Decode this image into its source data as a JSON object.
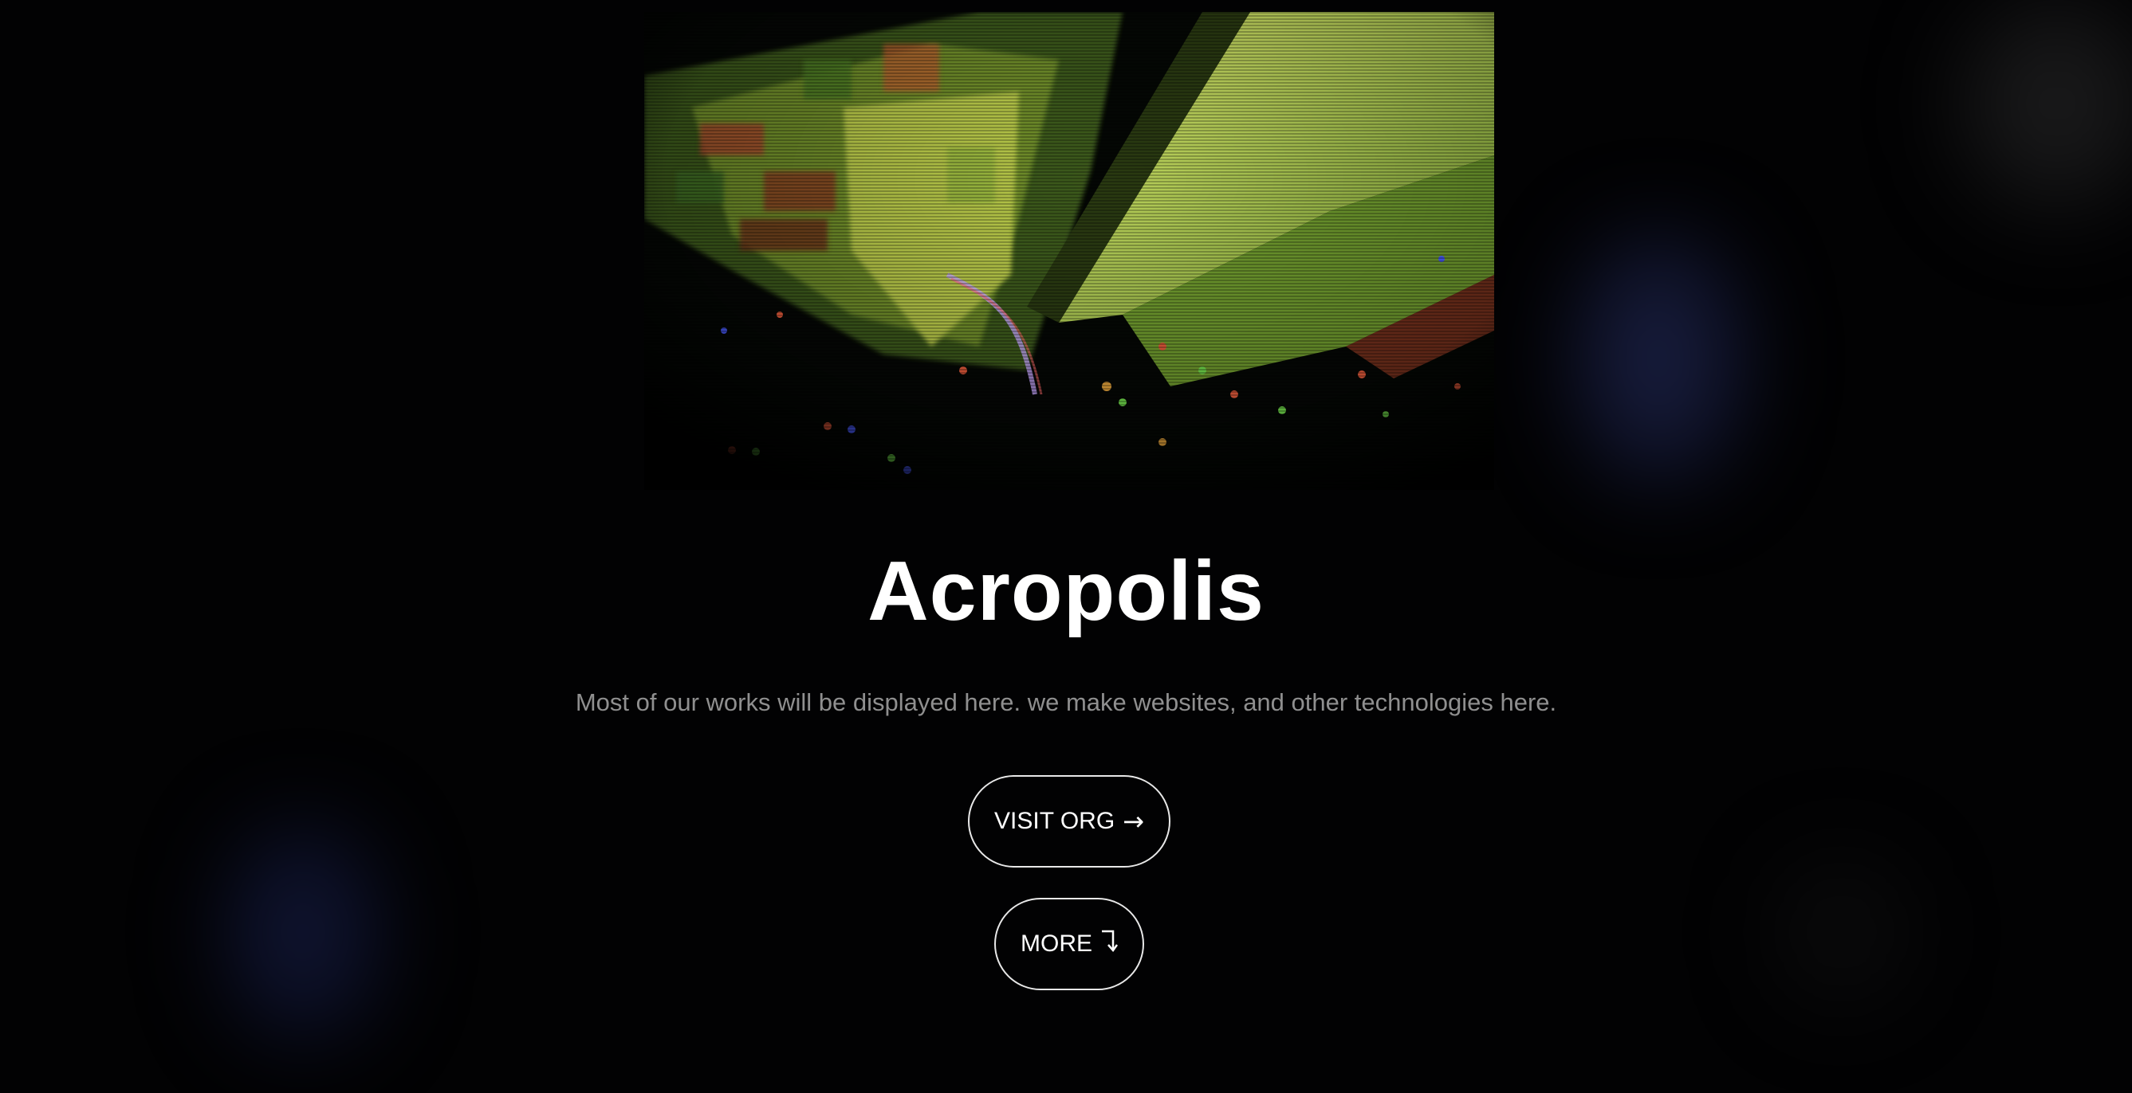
{
  "hero": {
    "title": "Acropolis",
    "subtitle": "Most of our works will be displayed here. we make websites, and other technologies here."
  },
  "buttons": {
    "visit_label": "VISIT ORG",
    "visit_icon": "→",
    "more_label": "MORE",
    "more_icon": "⮧"
  },
  "colors": {
    "background": "#020203",
    "text": "#ffffff",
    "muted_text": "#8f8f8f",
    "image_green": "#b5d94a"
  }
}
